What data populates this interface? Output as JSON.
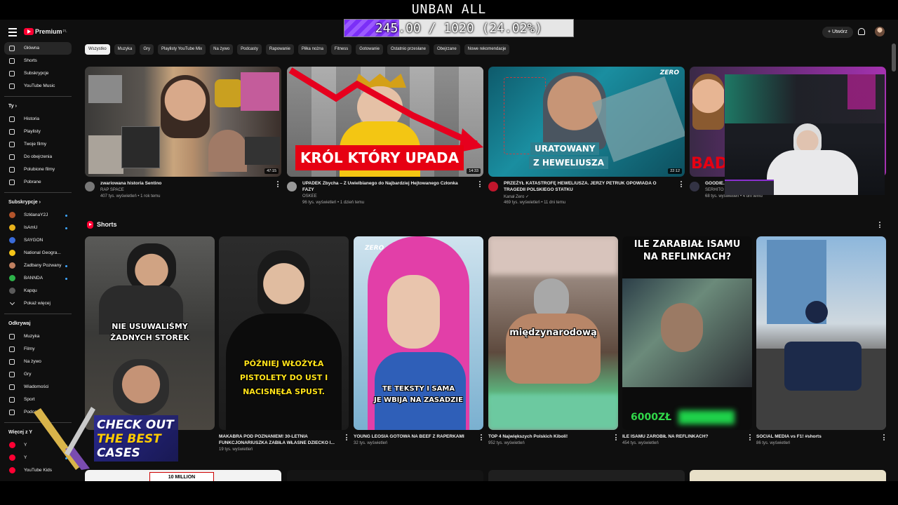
{
  "overlay": {
    "title": "UNBAN ALL",
    "progress_text": "245.00 / 1020 (24.02%)",
    "progress_fraction": 0.2402
  },
  "masthead": {
    "logo_text": "Premium",
    "logo_region": "PL",
    "create_label": "Utwórz"
  },
  "sidebar": {
    "main": [
      {
        "label": "Główna",
        "icon": "home-icon"
      },
      {
        "label": "Shorts",
        "icon": "shorts-icon"
      },
      {
        "label": "Subskrypcje",
        "icon": "subscriptions-icon"
      },
      {
        "label": "YouTube Music",
        "icon": "music-icon"
      }
    ],
    "you_header": "Ty",
    "you": [
      {
        "label": "Historia",
        "icon": "history-icon"
      },
      {
        "label": "Playlisty",
        "icon": "playlist-icon"
      },
      {
        "label": "Twoje filmy",
        "icon": "your-videos-icon"
      },
      {
        "label": "Do obejrzenia",
        "icon": "watch-later-icon"
      },
      {
        "label": "Polubione filmy",
        "icon": "like-icon"
      },
      {
        "label": "Pobrane",
        "icon": "download-icon"
      }
    ],
    "subs_header": "Subskrypcje",
    "subs": [
      {
        "label": "SzklanaY2J",
        "color": "#b3542b"
      },
      {
        "label": "IsAmU",
        "color": "#e8b21c"
      },
      {
        "label": "SAYGON",
        "color": "#3a6bd8"
      },
      {
        "label": "National Geogra...",
        "color": "#f5c518"
      },
      {
        "label": "Zadbany Pozwany",
        "color": "#c08060"
      },
      {
        "label": "BANNDA",
        "color": "#2db34a"
      },
      {
        "label": "Kapqu",
        "color": "#5a5a5a"
      }
    ],
    "show_more": "Pokaż więcej",
    "explore_header": "Odkrywaj",
    "explore": [
      {
        "label": "Muzyka",
        "icon": "music-note-icon"
      },
      {
        "label": "Filmy",
        "icon": "film-icon"
      },
      {
        "label": "Na żywo",
        "icon": "live-icon"
      },
      {
        "label": "Gry",
        "icon": "gaming-icon"
      },
      {
        "label": "Wiadomości",
        "icon": "news-icon"
      },
      {
        "label": "Sport",
        "icon": "trophy-icon"
      },
      {
        "label": "Podcasty",
        "icon": "podcast-icon"
      }
    ],
    "more_header": "Więcej z Y",
    "more": [
      {
        "label": "Y",
        "color": "#ff0033"
      },
      {
        "label": "Y",
        "color": "#ff0033"
      },
      {
        "label": "YouTube Kids",
        "color": "#ff0033"
      }
    ]
  },
  "chips": [
    "Wszystko",
    "Muzyka",
    "Gry",
    "Playlisty YouTube Mix",
    "Na żywo",
    "Podcasty",
    "Rapowanie",
    "Piłka nożna",
    "Fitness",
    "Gotowanie",
    "Ostatnio przesłane",
    "Obejrzane",
    "Nowe rekomendacje"
  ],
  "videos": [
    {
      "title": "zwariowana historia Sentino",
      "channel": "RAP SPACE",
      "stats": "407 tys. wyświetleń • 1 rok temu",
      "duration": "47:15"
    },
    {
      "title": "UPADEK Zbycha – Z Uwielbianego do Najbardziej Hejtowanego Członka FAZY",
      "channel": "OSKEE",
      "stats": "96 tys. wyświetleń • 1 dzień temu",
      "duration": "14:33",
      "thumb_text": "KRÓL KTÓRY UPADA"
    },
    {
      "title": "PRZEŻYŁ KATASTROFĘ HEWELIUSZA. JERZY PETRUK OPOWIADA O TRAGEDII POLSKIEGO STATKU",
      "channel": "Kanał Zero",
      "stats": "469 tys. wyświetleń • 11 dni temu",
      "duration": "22:12",
      "thumb_text_1": "URATOWANY",
      "thumb_text_2": "Z HEWELIUSZA",
      "badge": "ZERO"
    },
    {
      "title": "GOODIE...",
      "channel": "SERHITO",
      "stats": "68 tys. wyświetleń • 4 dni temu",
      "thumb_text": "BAD"
    }
  ],
  "shorts_section": {
    "title": "Shorts",
    "items": [
      {
        "title": "",
        "views": "",
        "caption_1": "NIE USUWALIŚMY",
        "caption_2": "ŻADNYCH STOREK"
      },
      {
        "title": "MAKABRA POD POZNANIEM! 30-LETNIA FUNKCJONARIUSZKA ZABIŁA WŁASNE DZIECKO I...",
        "views": "19 tys. wyświetleń",
        "caption": "PÓŹNIEJ WŁOŻYŁA PISTOLETY DO UST I NACISNĘŁA SPUST."
      },
      {
        "title": "YOUNG LEOSIA GOTOWA NA BEEF Z RAPERKAMI",
        "views": "32 tys. wyświetleń",
        "caption_1": "TE TEKSTY I SAMA",
        "caption_2": "JE WBIJA NA ZASADZIE",
        "badge": "ZERO"
      },
      {
        "title": "TOP 4 Największych Polskich Kiboli!",
        "views": "952 tys. wyświetleń",
        "caption": "międzynarodową"
      },
      {
        "title": "ILE ISAMU ZAROBIŁ NA REFLINKACH?",
        "views": "454 tys. wyświetleń",
        "caption_1": "ILE ZARABIAŁ ISAMU",
        "caption_2": "NA REFLINKACH?",
        "caption_3": "6000ZŁ"
      },
      {
        "title": "SOCIAL MEDIA vs F1! #shorts",
        "views": "86 tys. wyświetleń"
      }
    ]
  },
  "bottom_row": {
    "label": "10 MILLION"
  },
  "ad": {
    "line1": "CHECK OUT",
    "line2": "THE BEST",
    "line3": "CASES"
  }
}
